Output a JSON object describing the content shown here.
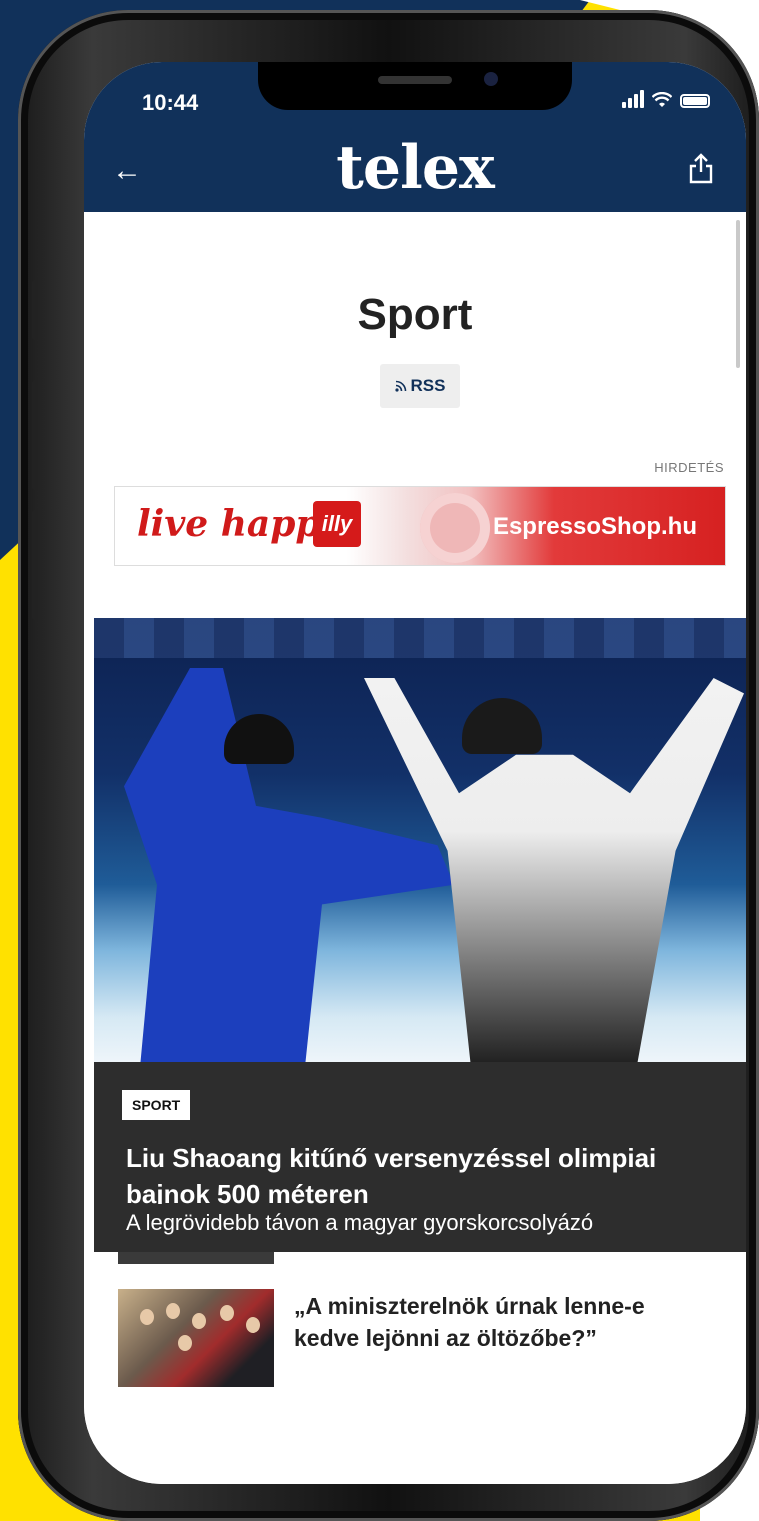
{
  "status_bar": {
    "time": "10:44"
  },
  "header": {
    "brand": "telex"
  },
  "page": {
    "title": "Sport",
    "rss_label": "RSS"
  },
  "ad": {
    "label": "HIRDETÉS",
    "script_text": "live happ",
    "logo_text": "illy",
    "shop_text": "EspressoShop.hu"
  },
  "hero": {
    "tag": "SPORT",
    "headline": "Liu Shaoang kitűnő versenyzéssel olimpiai bajnok 500 méteren",
    "lead": "A legrövidebb távon a magyar gyorskorcsolyázó"
  },
  "list": [
    {
      "title": "„A miniszterelnök úrnak lenne-e kedve lejönni az öltözőbe?”"
    }
  ],
  "colors": {
    "navy": "#11315a",
    "yellow": "#ffe100",
    "accent_red": "#d62121",
    "caption_bg": "#2d2d2d"
  }
}
